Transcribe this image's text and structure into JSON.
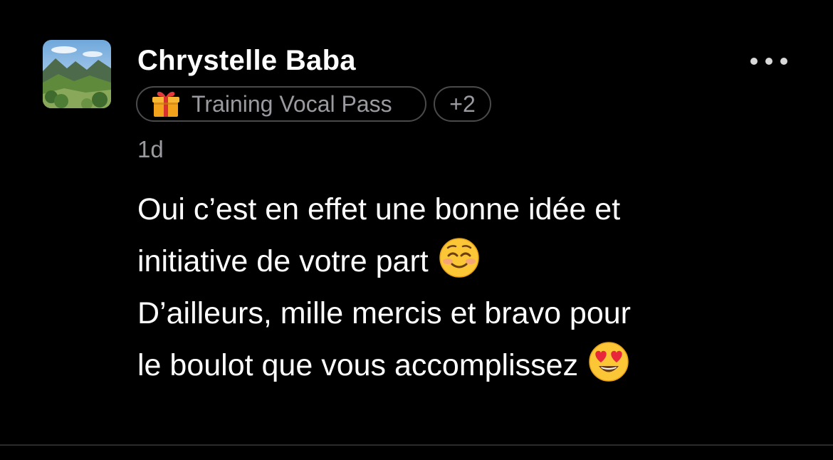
{
  "post": {
    "author": "Chrystelle Baba",
    "badge_label": "Training Vocal Pass",
    "badge_icon": "gift-icon",
    "badge_more": "+2",
    "timestamp": "1d",
    "body_lines": [
      "Oui c’est en effet une bonne idée et",
      "initiative de votre part",
      "D’ailleurs, mille mercis et bravo pour",
      "le boulot que vous accomplissez"
    ],
    "emoji_1": "smiling-face-icon",
    "emoji_2": "heart-eyes-face-icon"
  },
  "colors": {
    "background": "#000000",
    "text_primary": "#ffffff",
    "text_secondary": "#9a9aa0",
    "pill_border": "#4a4a4d"
  }
}
